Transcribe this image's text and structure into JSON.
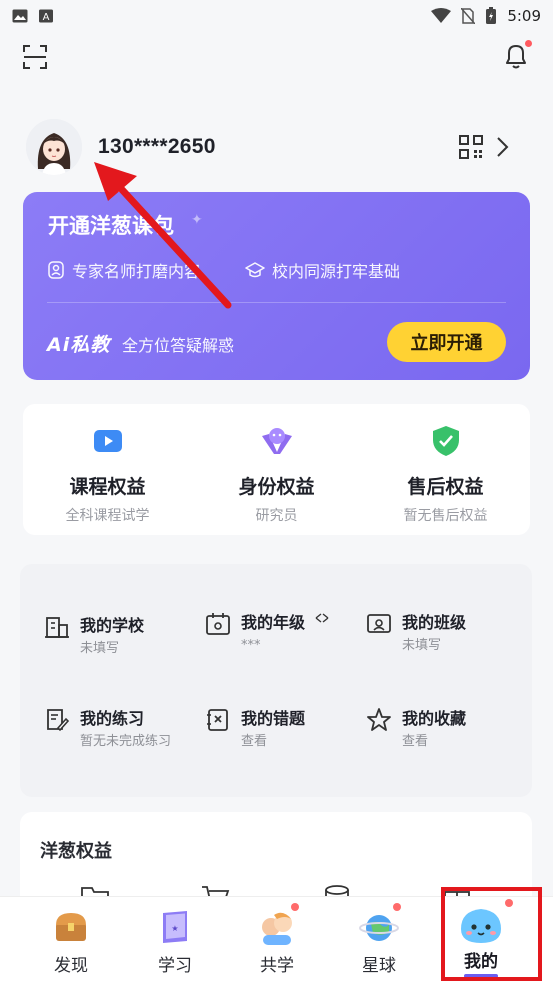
{
  "status_bar": {
    "time": "5:09"
  },
  "profile": {
    "phone": "130****2650"
  },
  "promo": {
    "title": "开通洋葱课包",
    "feature_1": "专家名师打磨内容",
    "feature_2": "校内同源打牢基础",
    "ai_logo": "Ai私教",
    "ai_desc": "全方位答疑解惑",
    "cta": "立即开通"
  },
  "rights": [
    {
      "title": "课程权益",
      "sub": "全科课程试学"
    },
    {
      "title": "身份权益",
      "sub": "研究员"
    },
    {
      "title": "售后权益",
      "sub": "暂无售后权益"
    }
  ],
  "grid": [
    {
      "title": "我的学校",
      "sub": "未填写"
    },
    {
      "title": "我的年级",
      "sub": "***"
    },
    {
      "title": "我的班级",
      "sub": "未填写"
    },
    {
      "title": "我的练习",
      "sub": "暂无未完成练习"
    },
    {
      "title": "我的错题",
      "sub": "查看"
    },
    {
      "title": "我的收藏",
      "sub": "查看"
    }
  ],
  "onion_rights": {
    "title": "洋葱权益"
  },
  "bottom_nav": [
    {
      "label": "发现"
    },
    {
      "label": "学习"
    },
    {
      "label": "共学"
    },
    {
      "label": "星球"
    },
    {
      "label": "我的"
    }
  ],
  "colors": {
    "accent": "#7a68f0",
    "cta": "#ffd233",
    "highlight": "#e3181d"
  }
}
